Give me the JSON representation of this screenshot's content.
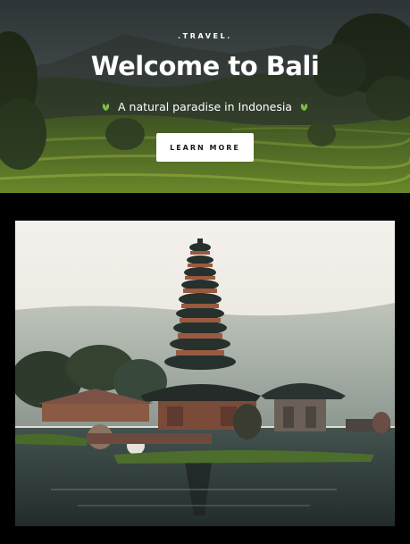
{
  "hero": {
    "eyebrow": ".TRAVEL.",
    "title": "Welcome to Bali",
    "subtitle": "A natural paradise in Indonesia",
    "cta_label": "LEARN MORE",
    "leaf_icon": "leaf-icon"
  },
  "gallery": {
    "image_icon": "temple-photo"
  },
  "colors": {
    "page_background": "#000000",
    "cta_background": "#ffffff",
    "cta_text": "#1a1a1a",
    "title_text": "#ffffff",
    "leaf_green": "#7fbf3f"
  }
}
